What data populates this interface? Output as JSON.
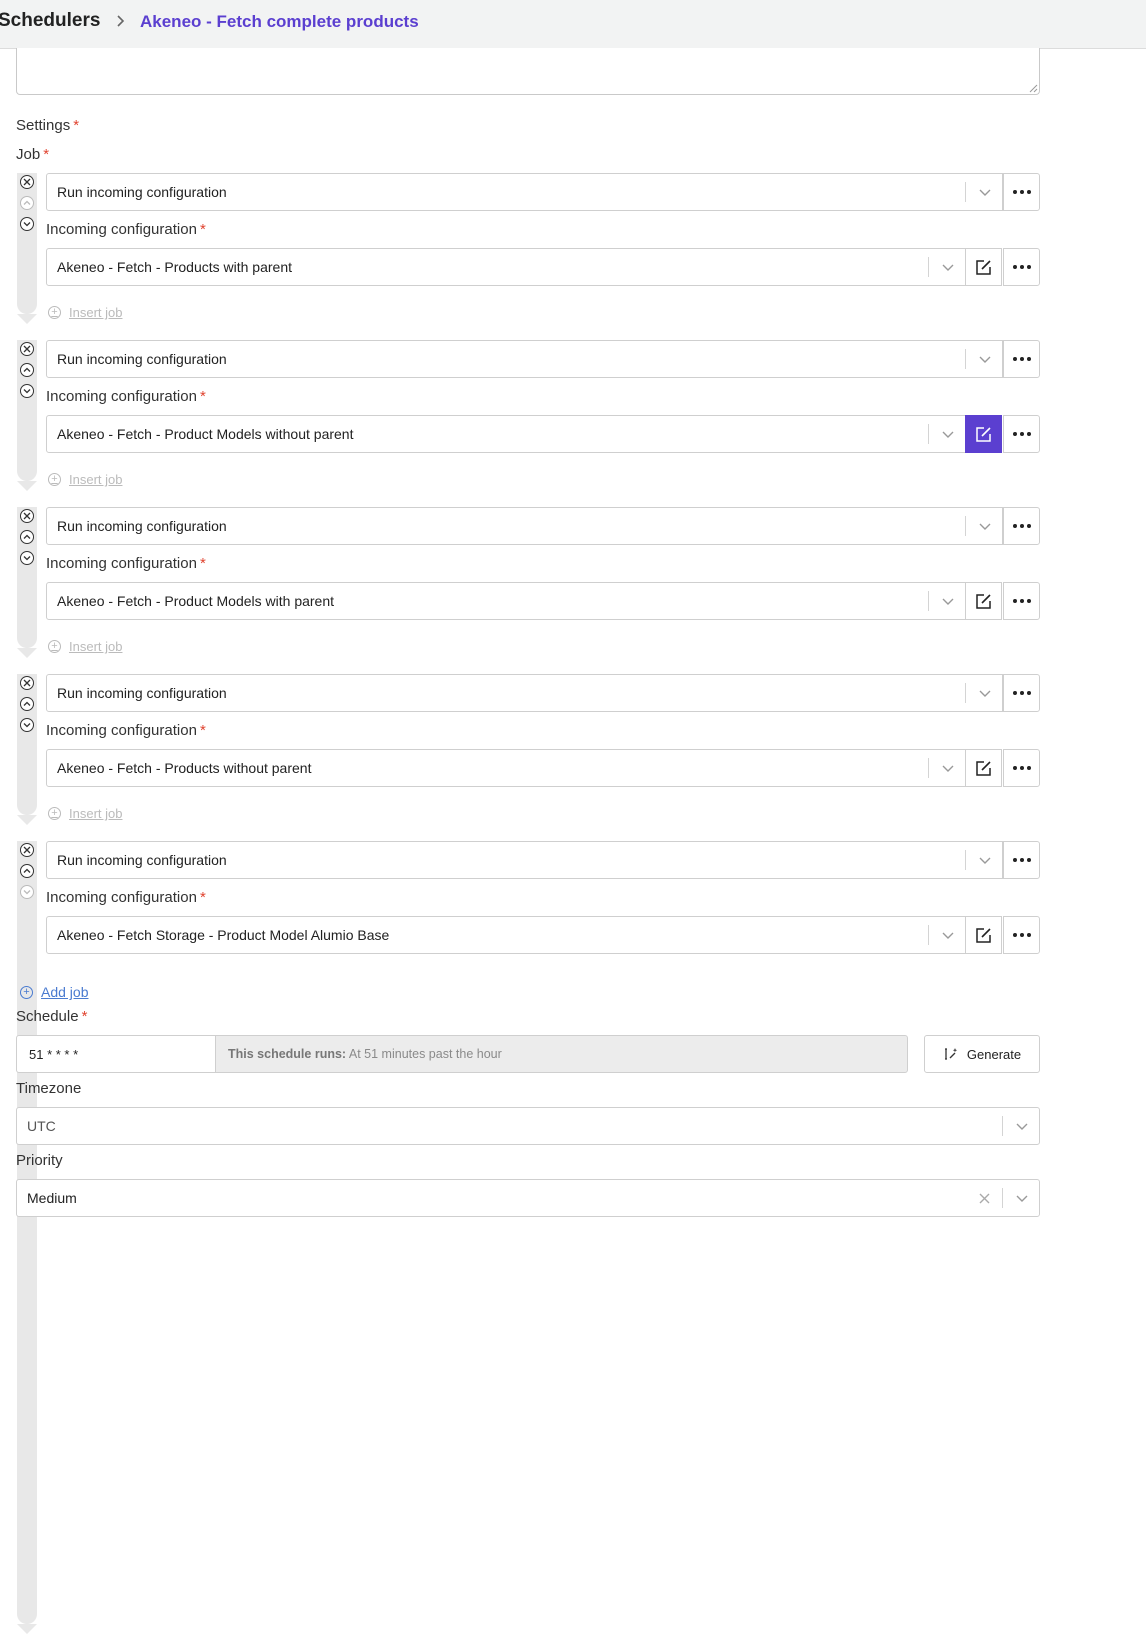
{
  "breadcrumb": {
    "root": "Schedulers",
    "current": "Akeneo - Fetch complete products"
  },
  "form": {
    "settings_label": "Settings",
    "job_label": "Job",
    "required_mark": "*",
    "jobs": [
      {
        "type": "Run incoming configuration",
        "config_label": "Incoming configuration",
        "config": "Akeneo - Fetch - Products with parent",
        "insert_label": "Insert job"
      },
      {
        "type": "Run incoming configuration",
        "config_label": "Incoming configuration",
        "config": "Akeneo - Fetch - Product Models without parent",
        "insert_label": "Insert job"
      },
      {
        "type": "Run incoming configuration",
        "config_label": "Incoming configuration",
        "config": "Akeneo - Fetch - Product Models with parent",
        "insert_label": "Insert job"
      },
      {
        "type": "Run incoming configuration",
        "config_label": "Incoming configuration",
        "config": "Akeneo - Fetch - Products without parent",
        "insert_label": "Insert job"
      },
      {
        "type": "Run incoming configuration",
        "config_label": "Incoming configuration",
        "config": "Akeneo - Fetch Storage - Product Model Alumio Base"
      }
    ],
    "add_job_label": "Add job",
    "schedule": {
      "label": "Schedule",
      "value": "51 * * * *",
      "runs_label": "This schedule runs:",
      "runs_desc": "At 51 minutes past the hour",
      "generate_label": "Generate"
    },
    "timezone": {
      "label": "Timezone",
      "value": "UTC"
    },
    "priority": {
      "label": "Priority",
      "value": "Medium"
    }
  },
  "colors": {
    "accent": "#5b3fd0",
    "required": "#e0432f",
    "link": "#4a7bd0"
  }
}
